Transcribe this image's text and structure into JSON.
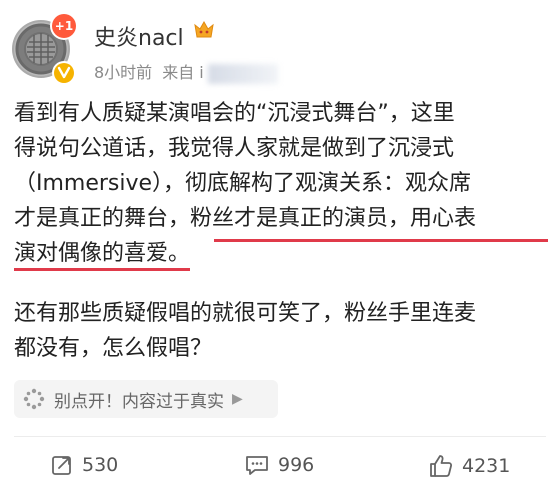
{
  "user": {
    "name": "史炎nacl",
    "notification_count": "+1",
    "time": "8小时前",
    "source_prefix": "来自 i"
  },
  "post": {
    "lines": [
      "看到有人质疑某演唱会的“沉浸式舞台”，这里",
      "得说句公道话，我觉得人家就是做到了沉浸式",
      "（Immersive），彻底解构了观演关系：观众席",
      "才是真正的舞台，粉丝才是真正的演员，用心表",
      "演对偶像的喜爱。"
    ],
    "para2_lines": [
      "还有那些质疑假唱的就很可笑了，粉丝手里连麦",
      "都没有，怎么假唱？"
    ]
  },
  "spoiler": {
    "label": "别点开！内容过于真实",
    "icon": "spoiler-icon"
  },
  "actions": {
    "repost": "530",
    "comment": "996",
    "like": "4231"
  },
  "colors": {
    "underline": "#e03a4a",
    "badge": "#ff5a3c",
    "verified": "#f6b300"
  }
}
